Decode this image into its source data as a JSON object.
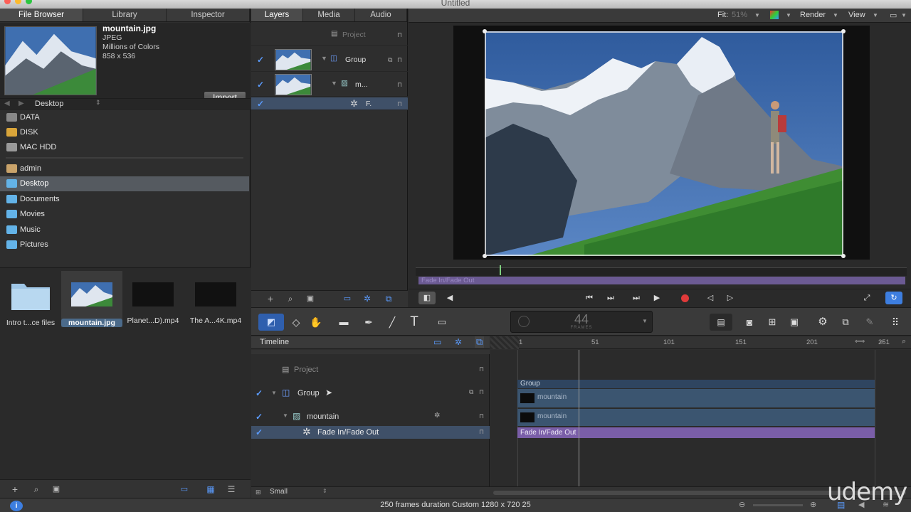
{
  "window": {
    "title": "Untitled"
  },
  "left_panel": {
    "tabs": [
      "File Browser",
      "Library",
      "Inspector"
    ],
    "preview": {
      "filename": "mountain.jpg",
      "format": "JPEG",
      "colors": "Millions of Colors",
      "size": "858 x 536",
      "import_label": "Import"
    },
    "path": "Desktop",
    "sources": [
      {
        "label": "DATA",
        "icon": "disk-icon"
      },
      {
        "label": "DISK",
        "icon": "disk-icon"
      },
      {
        "label": "MAC HDD",
        "icon": "disk-icon"
      },
      {
        "label": "admin",
        "icon": "home-icon"
      },
      {
        "label": "Desktop",
        "icon": "folder-icon"
      },
      {
        "label": "Documents",
        "icon": "folder-icon"
      },
      {
        "label": "Movies",
        "icon": "folder-icon"
      },
      {
        "label": "Music",
        "icon": "folder-icon"
      },
      {
        "label": "Pictures",
        "icon": "folder-icon"
      }
    ],
    "files": [
      "Intro t...ce files",
      "mountain.jpg",
      "Planet...D).mp4",
      "The A...4K.mp4"
    ]
  },
  "layers_panel": {
    "tabs": [
      "Layers",
      "Media",
      "Audio"
    ],
    "rows": [
      {
        "label": "Project"
      },
      {
        "label": "Group"
      },
      {
        "label": "m..."
      },
      {
        "label": "F."
      }
    ]
  },
  "canvas": {
    "fit_label": "Fit:",
    "fit_value": "51%",
    "render_label": "Render",
    "view_label": "View",
    "miniclip_label": "Fade In/Fade Out"
  },
  "toolbar": {
    "frame_counter": "44",
    "frame_unit": "FRAMES"
  },
  "timeline": {
    "title": "Timeline",
    "rows": [
      {
        "label": "Project"
      },
      {
        "label": "Group"
      },
      {
        "label": "mountain"
      },
      {
        "label": "Fade In/Fade Out"
      }
    ],
    "ruler": [
      "1",
      "51",
      "101",
      "151",
      "201",
      "251"
    ],
    "bars": {
      "group": "Group",
      "mountain1": "mountain",
      "mountain2": "mountain",
      "fade": "Fade In/Fade Out"
    },
    "size_label": "Small"
  },
  "status": {
    "message": "250 frames duration Custom 1280 x 720 25"
  },
  "watermark": "udemy",
  "colors": {
    "selection": "#555a60",
    "accent_blue": "#3d7ee0",
    "fade_purple": "#7a5ea8",
    "track_blue": "#3b5570",
    "record_red": "#e03a3a"
  }
}
